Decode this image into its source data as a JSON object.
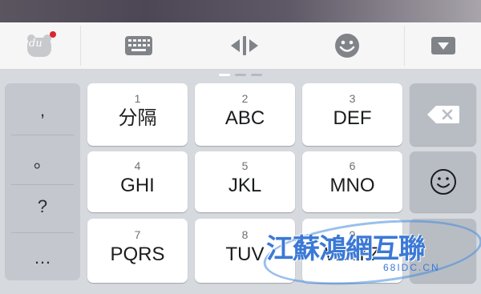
{
  "toolbar": {
    "logo_text": "du",
    "icons": [
      "baidu-logo-icon",
      "keyboard-icon",
      "cursor-move-icon",
      "emoji-icon",
      "collapse-keyboard-icon"
    ]
  },
  "keys": [
    {
      "num": "1",
      "label": "分隔"
    },
    {
      "num": "2",
      "label": "ABC"
    },
    {
      "num": "3",
      "label": "DEF"
    },
    {
      "num": "4",
      "label": "GHI"
    },
    {
      "num": "5",
      "label": "JKL"
    },
    {
      "num": "6",
      "label": "MNO"
    },
    {
      "num": "7",
      "label": "PQRS"
    },
    {
      "num": "8",
      "label": "TUV"
    },
    {
      "num": "9",
      "label": "WXYZ"
    }
  ],
  "punctuation": [
    ",",
    "。",
    "?",
    "…"
  ],
  "watermark": {
    "text": "江蘇鴻網互聯",
    "sub": "68IDC.CN"
  },
  "colors": {
    "keyboard_bg": "#d6d9de",
    "key_bg": "#ffffff",
    "function_key_bg": "#b8bdc4",
    "notification_dot": "#d9262c"
  }
}
